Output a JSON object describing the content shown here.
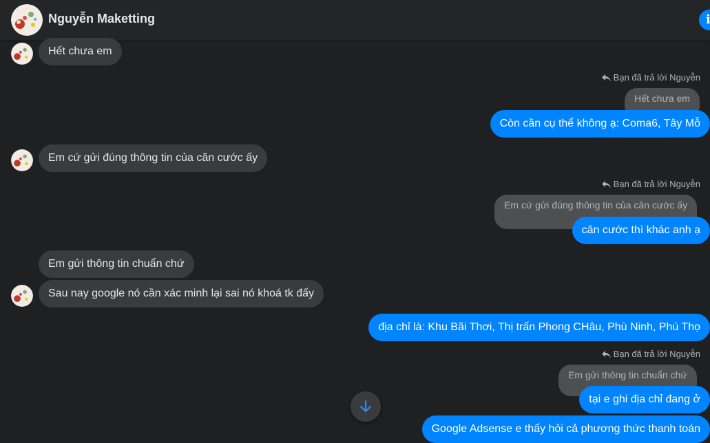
{
  "header": {
    "contact_name": "Nguyễn Maketting",
    "info_icon": "info-icon"
  },
  "messages": {
    "m1": "Hết chưa em",
    "reply_note_1": "Bạn đã trả lời Nguyễn",
    "quote_1": "Hết chưa em",
    "m2": "Còn cần cụ thể không ạ:  Coma6, Tây Mỗ",
    "m3": "Em cứ gửi đúng thông tin của căn cước ấy",
    "reply_note_2": "Bạn đã trả lời Nguyễn",
    "quote_2": "Em cứ gửi đúng thông tin của căn cước ấy",
    "m4": "căn cước thì khác anh ạ",
    "m5": "Em gửi thông tin chuẩn chứ",
    "m6": "Sau nay google nó cần xác minh lại sai nó khoá tk đấy",
    "m7": "địa chỉ là: Khu Bãi Thơi, Thị trấn Phong CHâu, Phù Ninh, Phú Thọ",
    "reply_note_3": "Bạn đã trả lời Nguyễn",
    "quote_3": "Em gửi thông tin chuẩn chứ",
    "m8": "tại e ghi địa chỉ đang ở",
    "m9": "Google Adsense e thấy hỏi cả phương thức thanh toán"
  },
  "colors": {
    "background": "#1f2021",
    "incoming_bubble": "#3a3b3c",
    "outgoing_bubble": "#0084ff",
    "quoted_bubble": "#4e4f50"
  },
  "icons": {
    "reply": "reply-arrow-icon",
    "scroll_down": "arrow-down-icon"
  }
}
